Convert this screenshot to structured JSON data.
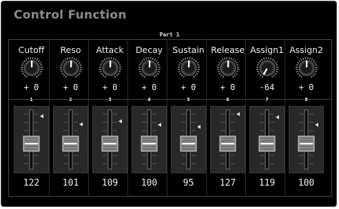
{
  "window": {
    "title": "Control Function"
  },
  "part_label": "Part 1",
  "channels": [
    {
      "name": "Cutoff",
      "knob_value": "+ 0",
      "number": "1",
      "fader_value": "122",
      "fader_level": 0.96
    },
    {
      "name": "Reso",
      "knob_value": "+ 0",
      "number": "2",
      "fader_value": "101",
      "fader_level": 0.8
    },
    {
      "name": "Attack",
      "knob_value": "+ 0",
      "number": "3",
      "fader_value": "109",
      "fader_level": 0.86
    },
    {
      "name": "Decay",
      "knob_value": "+ 0",
      "number": "4",
      "fader_value": "100",
      "fader_level": 0.79
    },
    {
      "name": "Sustain",
      "knob_value": "+ 0",
      "number": "5",
      "fader_value": "95",
      "fader_level": 0.75
    },
    {
      "name": "Release",
      "knob_value": "+ 0",
      "number": "6",
      "fader_value": "127",
      "fader_level": 1.0
    },
    {
      "name": "Assign1",
      "knob_value": "-64",
      "number": "7",
      "fader_value": "119",
      "fader_level": 0.94
    },
    {
      "name": "Assign2",
      "knob_value": "+ 0",
      "number": "8",
      "fader_value": "100",
      "fader_level": 0.79
    }
  ],
  "knob_range": {
    "min": -64,
    "max": 63
  },
  "fader_range": {
    "min": 0,
    "max": 127
  },
  "colors": {
    "background": "#000000",
    "title": "#8c8c8c",
    "text": "#f2f2f2",
    "knob_body": "#3a3a3a",
    "knob_indicator": "#ffffff"
  }
}
